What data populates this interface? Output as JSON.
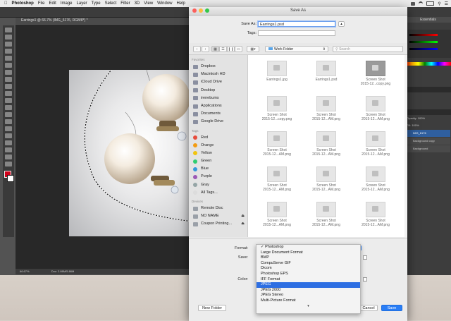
{
  "menubar": {
    "app": "Photoshop",
    "items": [
      "File",
      "Edit",
      "Image",
      "Layer",
      "Type",
      "Select",
      "Filter",
      "3D",
      "View",
      "Window",
      "Help"
    ]
  },
  "photoshop": {
    "doc_tab": "Earrings1 @ 66.7% (IMG_6176, RGB/8*) *",
    "status_zoom": "66.67%",
    "status_doc": "Doc: 2.86M/5.86M",
    "workspace": "Essentials",
    "opacity_label": "Opacity: 100%",
    "fill_label": "Fill: 100%",
    "layers": [
      {
        "name": "IMG_6176",
        "selected": true
      },
      {
        "name": "Background copy",
        "selected": false
      },
      {
        "name": "Background",
        "selected": false
      }
    ]
  },
  "dialog": {
    "title": "Save As",
    "save_as_label": "Save As:",
    "save_as_value": "Earrings1.psd",
    "tags_label": "Tags:",
    "tags_value": "",
    "location": "Work Folder",
    "search_placeholder": "Search",
    "sidebar": {
      "favorites_header": "Favorites",
      "favorites": [
        "Dropbox",
        "Macintosh HD",
        "iCloud Drive",
        "Desktop",
        "irenebums",
        "Applications",
        "Documents",
        "Google Drive"
      ],
      "tags_header": "Tags",
      "tags": [
        {
          "name": "Red",
          "color": "#e74c3c"
        },
        {
          "name": "Orange",
          "color": "#f39c12"
        },
        {
          "name": "Yellow",
          "color": "#f1c40f"
        },
        {
          "name": "Green",
          "color": "#2ecc71"
        },
        {
          "name": "Blue",
          "color": "#3498db"
        },
        {
          "name": "Purple",
          "color": "#9b59b6"
        },
        {
          "name": "Gray",
          "color": "#95a5a6"
        },
        {
          "name": "All Tags...",
          "color": "#dcdcdc"
        }
      ],
      "devices_header": "Devices",
      "devices": [
        "Remote Disc",
        "NO NAME",
        "Coupon Printing..."
      ]
    },
    "files": [
      {
        "line1": "Earrings1.jpg",
        "line2": "",
        "dark": false
      },
      {
        "line1": "Earrings1.psd",
        "line2": "",
        "dark": false
      },
      {
        "line1": "Screen Shot",
        "line2": "2015-12...copy.png",
        "dark": true
      },
      {
        "line1": "Screen Shot",
        "line2": "2015-12...copy.png",
        "dark": false
      },
      {
        "line1": "Screen Shot",
        "line2": "2015-12...AM.png",
        "dark": false
      },
      {
        "line1": "Screen Shot",
        "line2": "2015-12...AM.png",
        "dark": false
      },
      {
        "line1": "Screen Shot",
        "line2": "2015-12...AM.png",
        "dark": false
      },
      {
        "line1": "Screen Shot",
        "line2": "2015-12...AM.png",
        "dark": false
      },
      {
        "line1": "Screen Shot",
        "line2": "2015-12...AM.png",
        "dark": false
      },
      {
        "line1": "Screen Shot",
        "line2": "2015-12...AM.png",
        "dark": false
      },
      {
        "line1": "Screen Shot",
        "line2": "2015-12...AM.png",
        "dark": false
      },
      {
        "line1": "Screen Shot",
        "line2": "2015-12...AM.png",
        "dark": false
      },
      {
        "line1": "Screen Shot",
        "line2": "2015-12...AM.png",
        "dark": false
      },
      {
        "line1": "Screen Shot",
        "line2": "2015-12...AM.png",
        "dark": false
      },
      {
        "line1": "Screen Shot",
        "line2": "2015-12...AM.png",
        "dark": false
      }
    ],
    "format_label": "Format:",
    "save_label": "Save:",
    "color_label": "Color:",
    "format_options": [
      {
        "label": "✓ Photoshop",
        "selected": false
      },
      {
        "label": "Large Document Format",
        "selected": false
      },
      {
        "label": "BMP",
        "selected": false
      },
      {
        "label": "CompuServe GIF",
        "selected": false
      },
      {
        "label": "Dicom",
        "selected": false
      },
      {
        "label": "Photoshop EPS",
        "selected": false
      },
      {
        "label": "IFF Format",
        "selected": false
      },
      {
        "label": "JPEG",
        "selected": true
      },
      {
        "label": "JPEG 2000",
        "selected": false
      },
      {
        "label": "JPEG Stereo",
        "selected": false
      },
      {
        "label": "Multi-Picture Format",
        "selected": false
      }
    ],
    "menu_more_arrow": "▾",
    "new_folder_button": "New Folder",
    "cancel_button": "Cancel",
    "save_button": "Save"
  },
  "colors": {
    "accent": "#2a7ef6",
    "ps_bg": "#535353",
    "ps_panel": "#3d3d3d",
    "selection_blue": "#2d6ee2"
  }
}
